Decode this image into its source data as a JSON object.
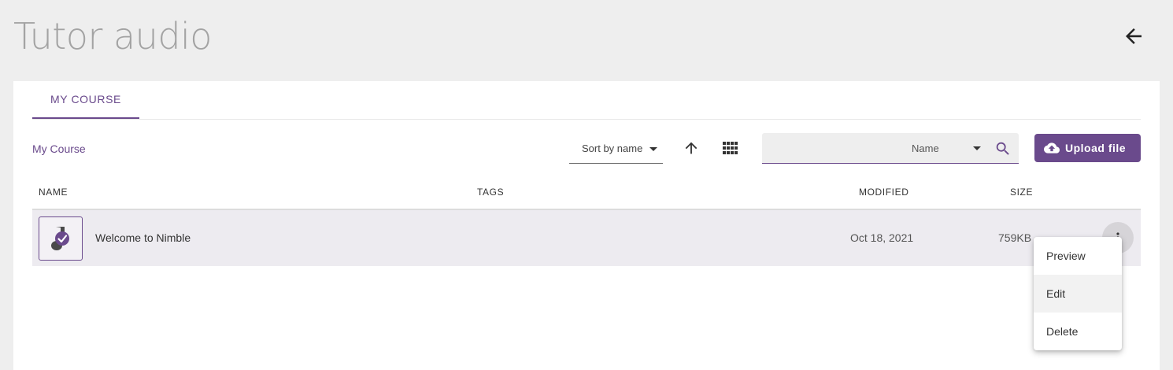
{
  "page": {
    "title": "Tutor audio"
  },
  "tabs": [
    {
      "label": "MY COURSE",
      "active": true
    }
  ],
  "breadcrumb": {
    "label": "My Course"
  },
  "toolbar": {
    "sort_label": "Sort by name",
    "sort_direction_icon": "arrow-up-icon",
    "view_icon": "grid-view-icon",
    "search": {
      "field": "Name",
      "value": ""
    },
    "upload_label": "Upload file"
  },
  "table": {
    "headers": {
      "name": "NAME",
      "tags": "TAGS",
      "modified": "MODIFIED",
      "size": "SIZE"
    },
    "rows": [
      {
        "name": "Welcome to Nimble",
        "tags": "",
        "modified": "Oct 18, 2021",
        "size": "759KB"
      }
    ]
  },
  "context_menu": {
    "items": [
      "Preview",
      "Edit",
      "Delete"
    ],
    "highlighted": "Edit"
  },
  "colors": {
    "accent": "#6a4a8c",
    "background": "#eeeeee",
    "row_selected": "#edebf0"
  }
}
